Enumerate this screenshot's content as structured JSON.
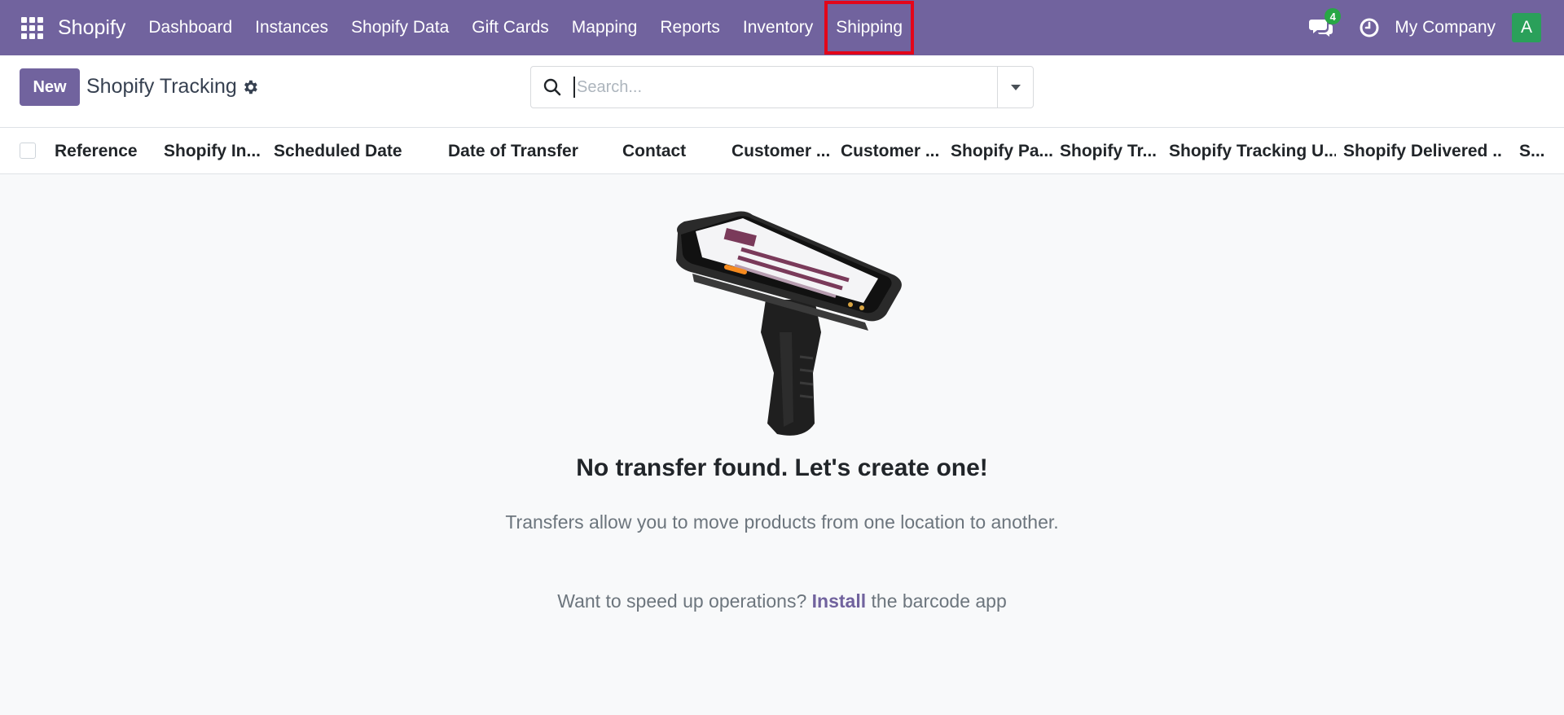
{
  "navbar": {
    "brand": "Shopify",
    "items": [
      {
        "label": "Dashboard"
      },
      {
        "label": "Instances"
      },
      {
        "label": "Shopify Data"
      },
      {
        "label": "Gift Cards"
      },
      {
        "label": "Mapping"
      },
      {
        "label": "Reports"
      },
      {
        "label": "Inventory"
      },
      {
        "label": "Shipping",
        "highlighted": true
      }
    ],
    "messages_badge": "4",
    "company": "My Company",
    "avatar_letter": "A",
    "color": "#71639e",
    "highlight_color": "#e3061a"
  },
  "control_panel": {
    "new_button": "New",
    "title": "Shopify Tracking",
    "search": {
      "placeholder": "Search...",
      "value": ""
    }
  },
  "list": {
    "columns": [
      "Reference",
      "Shopify In...",
      "Scheduled Date",
      "Date of Transfer",
      "Contact",
      "Customer ...",
      "Customer ...",
      "Shopify Pa...",
      "Shopify Tr...",
      "Shopify Tracking U...",
      "Shopify Delivered ...",
      "S..."
    ]
  },
  "empty_state": {
    "title": "No transfer found. Let's create one!",
    "subtitle": "Transfers allow you to move products from one location to another.",
    "barcode_prefix": "Want to speed up operations?",
    "barcode_link": "Install",
    "barcode_suffix": "the barcode app"
  }
}
